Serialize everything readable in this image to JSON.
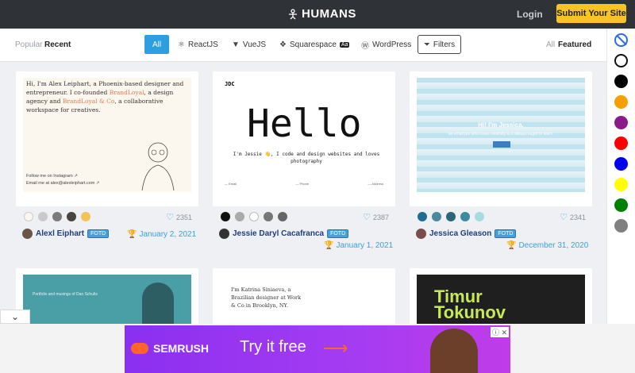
{
  "header": {
    "logo": "HUMANS",
    "login": "Login",
    "submit": "Submit Your Site"
  },
  "filters": {
    "popular": "Popular",
    "recent": "Recent",
    "tags": [
      "All",
      "ReactJS",
      "VueJS",
      "Squarespace",
      "WordPress"
    ],
    "filters_btn": "Filters",
    "all": "All",
    "featured": "Featured"
  },
  "colors": [
    "none",
    "#ffffff",
    "#000000",
    "#f5a000",
    "#8a1c8a",
    "#ff0000",
    "#0000ee",
    "#ffff00",
    "#008000",
    "#808080"
  ],
  "cards": [
    {
      "author": "Alexl Eiphart",
      "badge": "FOTD",
      "date": "January 2, 2021",
      "likes": "2351",
      "swatches": [
        "#fbf7ee",
        "#c9c9c9",
        "#7a7a7a",
        "#4a4441",
        "#efc45a"
      ],
      "preview": {
        "line1": "Hi, I'm Alex Leiphart, a Phoenix-based designer and entrepreneur. I co-founded ",
        "hl1": "BrandLoyal",
        "line2": ", a design agency and ",
        "hl2": "BrandLoyal & Co",
        "line3": ", a collaborative workspace for creatives.",
        "foot1": "Follow me on Instagram ↗",
        "foot2": "Email me at alex@alexleiphart.com ↗"
      }
    },
    {
      "author": "Jessie Daryl Cacafranca",
      "badge": "FOTD",
      "date": "January 1, 2021",
      "likes": "2387",
      "swatches": [
        "#111111",
        "#aaaaaa",
        "#ffffff",
        "#777777",
        "#666666"
      ],
      "preview": {
        "brand": "JDC",
        "hello": "Hello",
        "sub": "I'm Jessie 👋, I code and design websites and loves photography",
        "col1": "— Email",
        "col2": "— Phone",
        "col3": "— Address"
      }
    },
    {
      "author": "Jessica Gleason",
      "badge": "FOTD",
      "date": "December 31, 2020",
      "likes": "2341",
      "swatches": [
        "#1f6e8f",
        "#4a8a9a",
        "#2c6677",
        "#3d8aa0",
        "#a8dbe0"
      ],
      "preview": {
        "hi": "Hi! I'm Jessica.",
        "sub": "an email pro who loves creativity & is always eager to learn."
      }
    }
  ],
  "row2": [
    {
      "caption": "Portfolio and musings of Dan Schultz"
    },
    {
      "text": "I'm Katrina Siniaeva, a Brazilian designer at Work & Co in Brooklyn, NY."
    },
    {
      "name": "Timur Tokunov"
    }
  ],
  "ad": {
    "brand": "SEMRUSH",
    "cta": "Try it free",
    "close": "ⓘ ✕"
  }
}
